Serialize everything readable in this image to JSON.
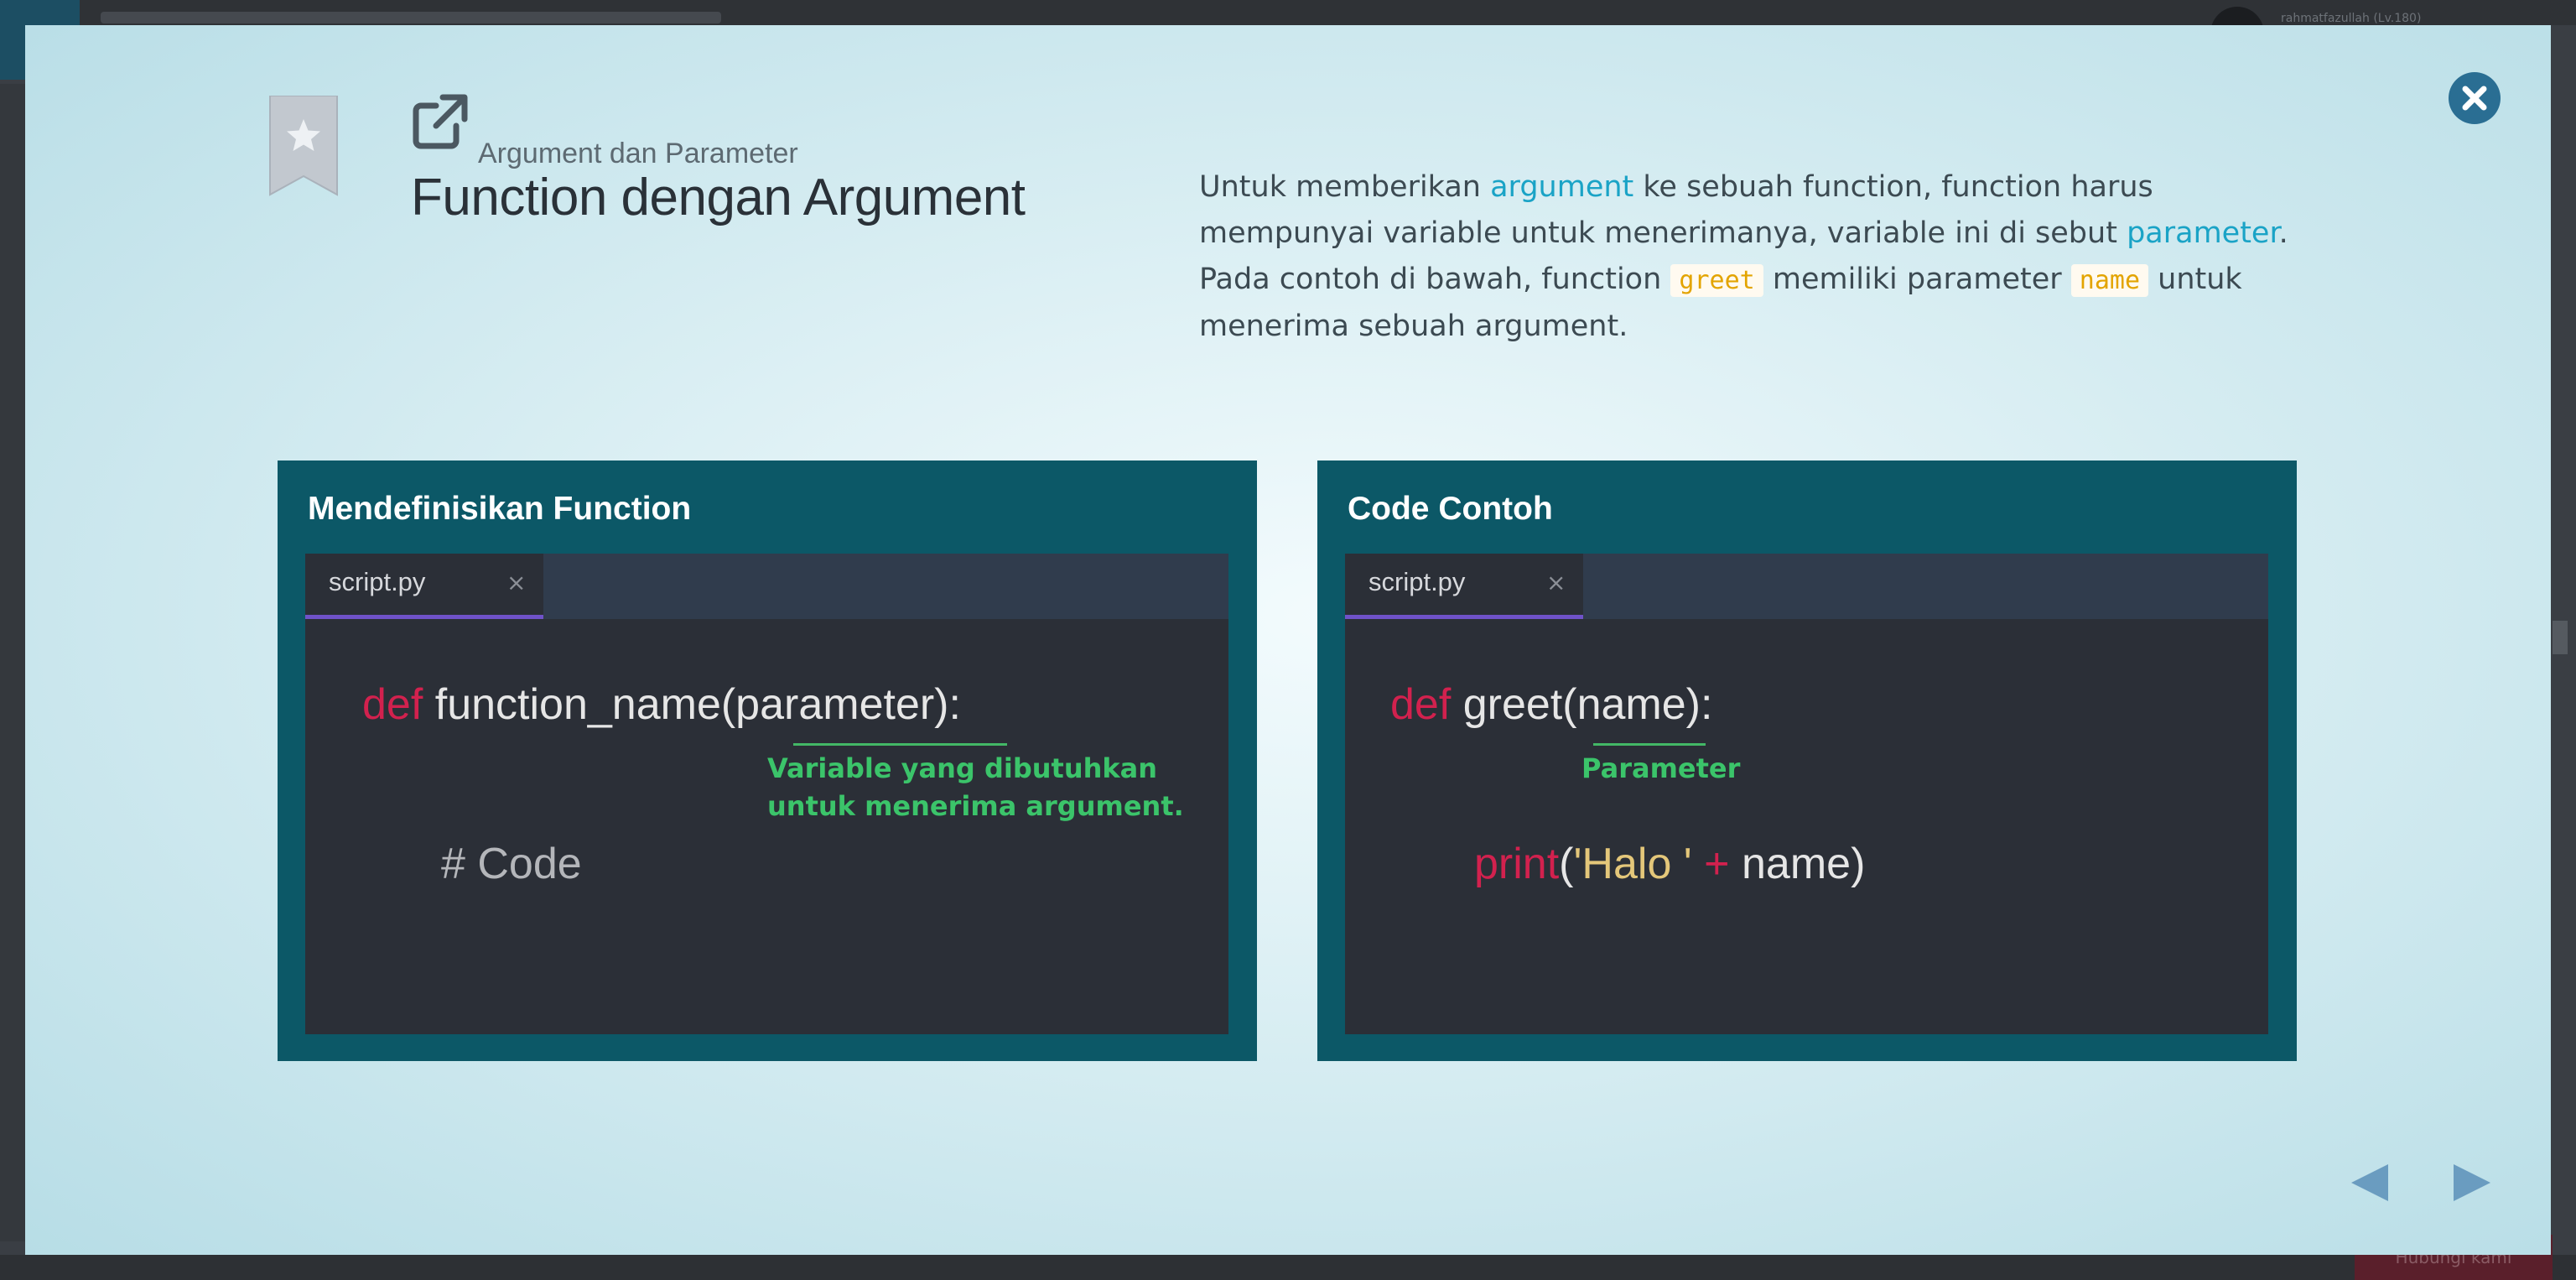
{
  "background": {
    "username": "rahmatfazullah (Lv.180)",
    "bottom_button_label": "Hubungi kami"
  },
  "modal": {
    "breadcrumb": "Argument dan Parameter",
    "title": "Function dengan Argument",
    "description": {
      "p1": "Untuk memberikan ",
      "link1": "argument",
      "p2": " ke sebuah function, function harus mempunyai variable untuk menerimanya, variable ini di sebut ",
      "link2": "parameter",
      "p3": ". Pada contoh di bawah, function ",
      "code1": "greet",
      "p4": " memiliki parameter ",
      "code2": "name",
      "p5": " untuk menerima sebuah argument."
    },
    "close_icon": "close-icon",
    "prev_icon": "prev-arrow-icon",
    "next_icon": "next-arrow-icon"
  },
  "panels": [
    {
      "title": "Mendefinisikan Function",
      "tab_label": "script.py",
      "tab_close": "×",
      "line1_kw": "def",
      "line1_rest": " function_name(parameter):",
      "annotation_1": "Variable yang dibutuhkan",
      "annotation_2": "untuk menerima argument.",
      "line2": "# Code"
    },
    {
      "title": "Code Contoh",
      "tab_label": "script.py",
      "tab_close": "×",
      "line1_kw": "def",
      "line1_rest": " greet(name):",
      "annotation_1": "Parameter",
      "line2_kw": "print",
      "line2_paren_open": "(",
      "line2_str": "'Halo '",
      "line2_op": " + ",
      "line2_rest": "name)"
    }
  ],
  "colors": {
    "panel_bg": "#0c5867",
    "editor_bg": "#2b2f37",
    "keyword": "#d2214e",
    "string": "#e4c77a",
    "annotation": "#3bc46a",
    "link": "#1aa3c6",
    "inline_code": "#e3a400",
    "close_button": "#2a6e93",
    "nav_arrow": "#6a9cc0"
  }
}
